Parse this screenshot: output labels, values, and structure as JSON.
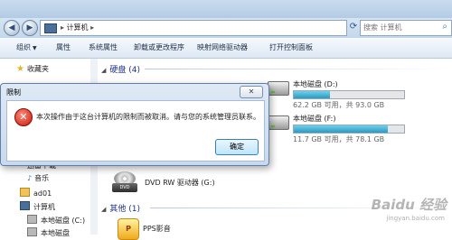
{
  "window": {
    "address_path": "计算机",
    "search_placeholder": "搜索 计算机"
  },
  "toolbar": {
    "organize": "组织",
    "properties": "属性",
    "system_properties": "系统属性",
    "uninstall": "卸载或更改程序",
    "map_drive": "映射网络驱动器",
    "control_panel": "打开控制面板"
  },
  "sidebar": {
    "favorites": "收藏夹",
    "thunder": "迅雷下载",
    "music": "音乐",
    "user": "ad01",
    "computer": "计算机",
    "local_c": "本地磁盘 (C:)",
    "local_more": "本地磁盘"
  },
  "main": {
    "hdd_group": "硬盘 (4)",
    "other_group": "其他 (1)",
    "drives": [
      {
        "name": "本地磁盘 (D:)",
        "info": "62.2 GB 可用，共 93.0 GB",
        "used_fraction": 0.33
      },
      {
        "name": "本地磁盘 (F:)",
        "info": "11.7 GB 可用，共 78.1 GB",
        "used_fraction": 0.85
      }
    ],
    "dvd": "DVD RW 驱动器 (G:)",
    "pps": "PPS影音"
  },
  "dialog": {
    "title": "限制",
    "message": "本次操作由于这台计算机的限制而被取消。请与您的系统管理员联系。",
    "ok": "确定",
    "close_glyph": "✕"
  },
  "watermark": {
    "brand": "Baidu 经验",
    "url": "jingyan.baidu.com"
  },
  "colors": {
    "bar_fill": "#2a9ac2",
    "dialog_bg": "#c9d9ec",
    "error_red": "#c6170c"
  }
}
